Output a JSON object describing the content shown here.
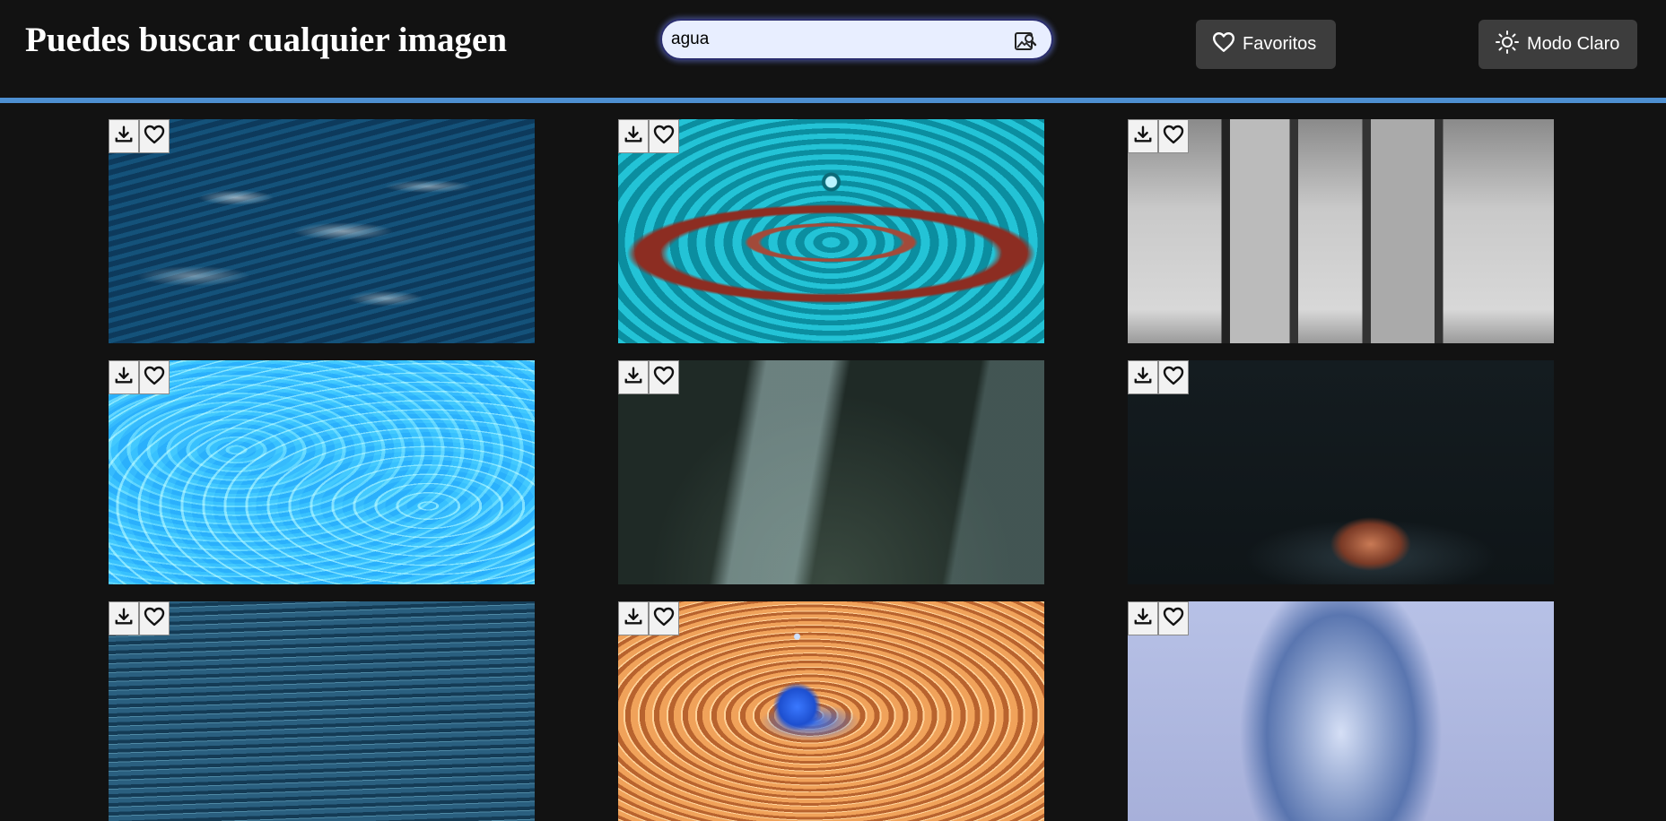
{
  "header": {
    "title": "Puedes buscar cualquier imagen",
    "search": {
      "value": "agua",
      "placeholder": ""
    },
    "favorites_label": "Favoritos",
    "theme_label": "Modo Claro"
  },
  "colors": {
    "background": "#121212",
    "button_bg": "#3d3d3d",
    "divider": "#4d8fd1",
    "search_bg": "#e8eeff"
  },
  "gallery": {
    "images": [
      {
        "name": "ocean-waves",
        "icons": [
          "download-icon",
          "heart-icon"
        ]
      },
      {
        "name": "teal-water-drop",
        "icons": [
          "download-icon",
          "heart-icon"
        ]
      },
      {
        "name": "glass-splash-bw",
        "icons": [
          "download-icon",
          "heart-icon"
        ]
      },
      {
        "name": "blue-pool-water",
        "icons": [
          "download-icon",
          "heart-icon"
        ]
      },
      {
        "name": "dark-water-splash",
        "icons": [
          "download-icon",
          "heart-icon"
        ]
      },
      {
        "name": "hand-in-dark-water",
        "icons": [
          "download-icon",
          "heart-icon"
        ]
      },
      {
        "name": "calm-sea-surface",
        "icons": [
          "download-icon",
          "heart-icon"
        ]
      },
      {
        "name": "orange-water-drop",
        "icons": [
          "download-icon",
          "heart-icon"
        ]
      },
      {
        "name": "blue-glass-splash",
        "icons": [
          "download-icon",
          "heart-icon"
        ]
      }
    ]
  }
}
